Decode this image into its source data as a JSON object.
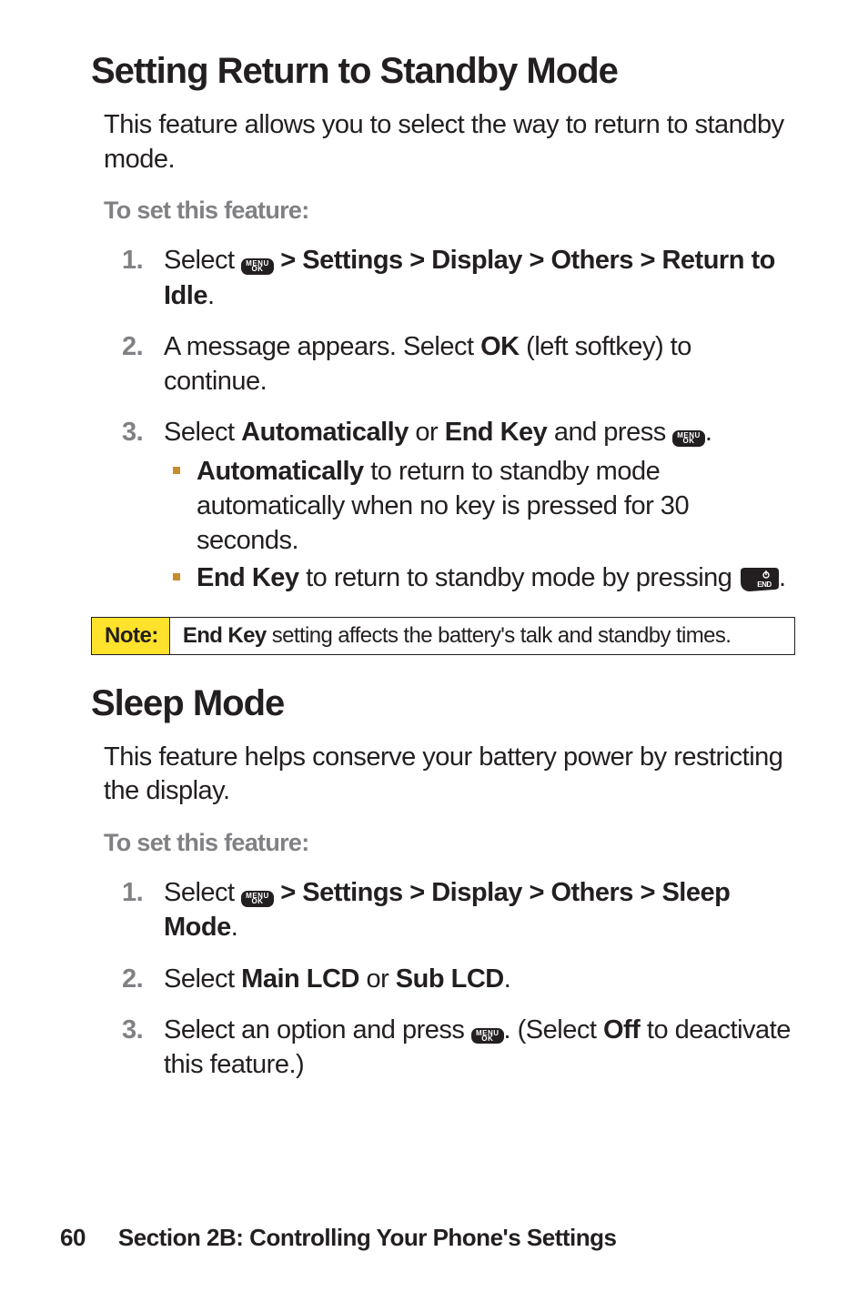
{
  "section1": {
    "heading": "Setting Return to Standby Mode",
    "intro": "This feature allows you to select the way to return to standby mode.",
    "subheading": "To set this feature:",
    "steps": {
      "s1": {
        "num": "1.",
        "pre": "Select ",
        "path": " > Settings > Display > Others > Return to Idle",
        "post": "."
      },
      "s2": {
        "num": "2.",
        "pre": "A message appears. Select ",
        "bold": "OK",
        "post": " (left softkey) to continue."
      },
      "s3": {
        "num": "3.",
        "pre": "Select ",
        "bold1": "Automatically",
        "mid": " or ",
        "bold2": "End Key",
        "post1": " and press ",
        "post2": ".",
        "sub": {
          "a": {
            "bold": "Automatically",
            "text": " to return to standby mode automatically when no key is pressed for 30 seconds."
          },
          "b": {
            "bold": "End Key",
            "text1": " to return to standby mode by pressing ",
            "text2": "."
          }
        }
      }
    }
  },
  "note": {
    "label": "Note:",
    "bold": "End Key",
    "text": " setting affects the battery's talk and standby times."
  },
  "section2": {
    "heading": "Sleep Mode",
    "intro": "This feature helps conserve your battery power by restricting the display.",
    "subheading": "To set this feature:",
    "steps": {
      "s1": {
        "num": "1.",
        "pre": "Select ",
        "path": " > Settings > Display > Others > Sleep Mode",
        "post": "."
      },
      "s2": {
        "num": "2.",
        "pre": "Select ",
        "bold1": "Main LCD",
        "mid": " or ",
        "bold2": "Sub LCD",
        "post": "."
      },
      "s3": {
        "num": "3.",
        "pre": "Select an option and press ",
        "mid": ". (Select ",
        "bold": "Off",
        "post": " to deactivate this feature.)"
      }
    }
  },
  "footer": {
    "page": "60",
    "section": "Section 2B: Controlling Your Phone's Settings"
  },
  "icons": {
    "menu_line1": "MENU",
    "menu_line2": "OK"
  }
}
